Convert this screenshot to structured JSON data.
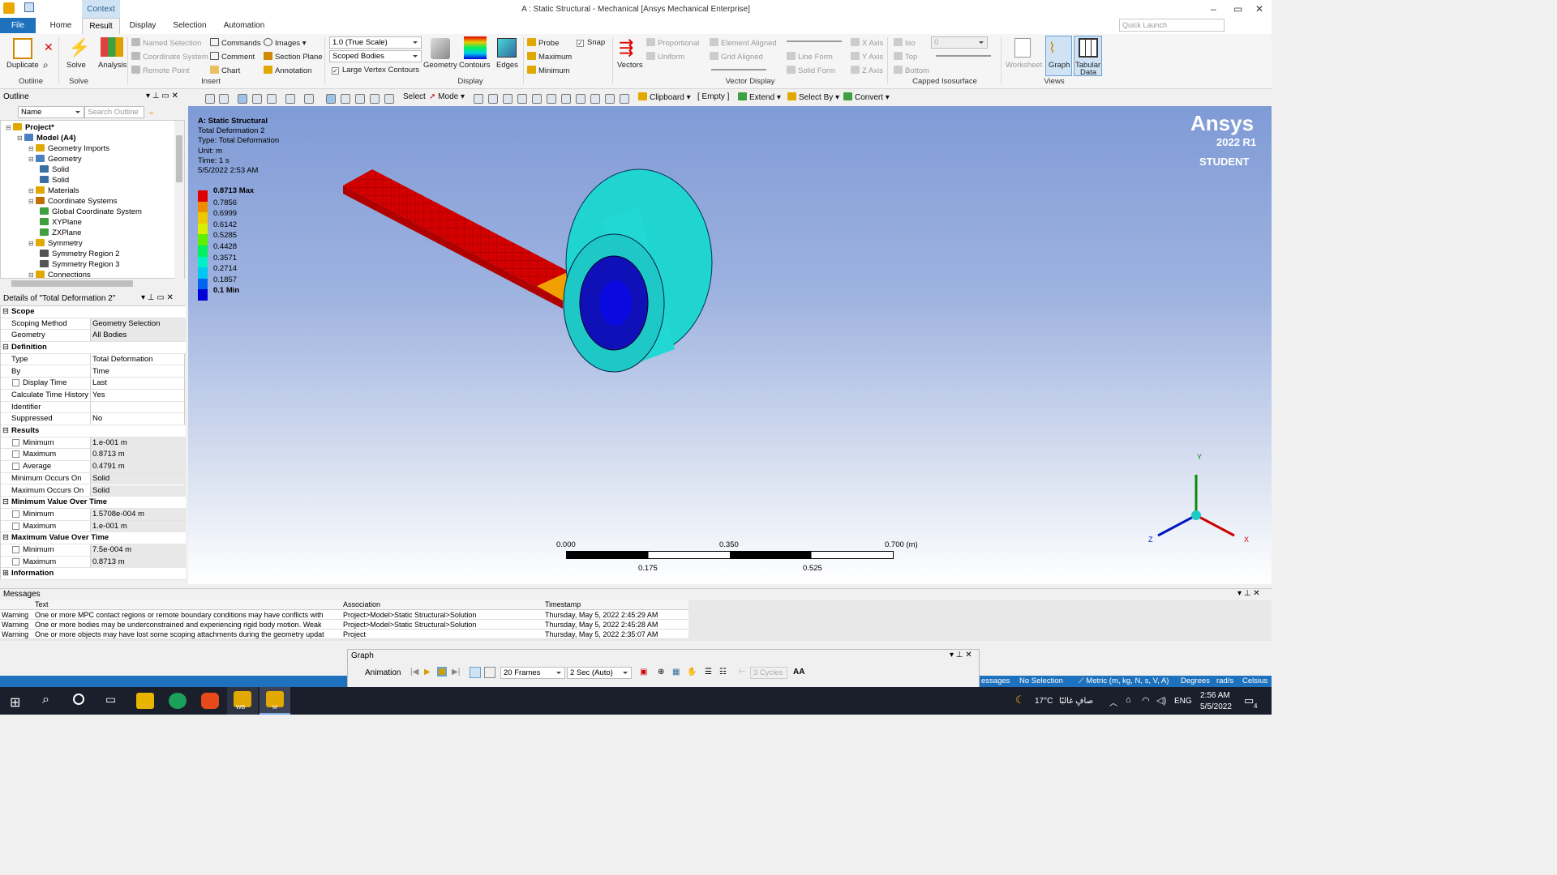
{
  "window": {
    "title": "A : Static Structural - Mechanical [Ansys Mechanical Enterprise]",
    "context_tab": "Context",
    "controls": [
      "–",
      "▭",
      "✕"
    ]
  },
  "ribbon_tabs": [
    "File",
    "Home",
    "Result",
    "Display",
    "Selection",
    "Automation"
  ],
  "quick_launch_placeholder": "Quick Launch",
  "ribbon": {
    "outline_group": "Outline",
    "duplicate": "Duplicate",
    "solve": "Solve",
    "solve_group": "Solve",
    "analysis": "Analysis",
    "named_selection": "Named Selection",
    "coordinate_system": "Coordinate System",
    "remote_point": "Remote Point",
    "commands": "Commands",
    "comment": "Comment",
    "chart": "Chart",
    "images": "Images",
    "section_plane": "Section Plane",
    "annotation": "Annotation",
    "insert_group": "Insert",
    "scale_value": "1.0 (True Scale)",
    "scoped_bodies": "Scoped Bodies",
    "large_vertex_contours": "Large Vertex Contours",
    "geometry": "Geometry",
    "contours": "Contours",
    "edges": "Edges",
    "display_group": "Display",
    "probe": "Probe",
    "maximum": "Maximum",
    "minimum": "Minimum",
    "snap": "Snap",
    "vectors": "Vectors",
    "proportional": "Proportional",
    "uniform": "Uniform",
    "element_aligned": "Element Aligned",
    "grid_aligned": "Grid Aligned",
    "line_form": "Line Form",
    "solid_form": "Solid Form",
    "x_axis": "X Axis",
    "y_axis": "Y Axis",
    "z_axis": "Z Axis",
    "vector_display_group": "Vector Display",
    "iso": "Iso",
    "top": "Top",
    "bottom": "Bottom",
    "iso_value": "0",
    "capped_group": "Capped Isosurface",
    "worksheet": "Worksheet",
    "graph": "Graph",
    "tabular_data_1": "Tabular",
    "tabular_data_2": "Data",
    "views_group": "Views"
  },
  "toolbar": {
    "select": "Select",
    "mode": "Mode",
    "clipboard": "Clipboard",
    "empty": "[ Empty ]",
    "extend": "Extend",
    "select_by": "Select By",
    "convert": "Convert"
  },
  "outline": {
    "header": "Outline",
    "name_filter": "Name",
    "search_placeholder": "Search Outline",
    "items": [
      {
        "label": "Project*",
        "depth": 0
      },
      {
        "label": "Model (A4)",
        "depth": 1
      },
      {
        "label": "Geometry Imports",
        "depth": 2
      },
      {
        "label": "Geometry",
        "depth": 2
      },
      {
        "label": "Solid",
        "depth": 3
      },
      {
        "label": "Solid",
        "depth": 3
      },
      {
        "label": "Materials",
        "depth": 2
      },
      {
        "label": "Coordinate Systems",
        "depth": 2
      },
      {
        "label": "Global Coordinate System",
        "depth": 3
      },
      {
        "label": "XYPlane",
        "depth": 3
      },
      {
        "label": "ZXPlane",
        "depth": 3
      },
      {
        "label": "Symmetry",
        "depth": 2
      },
      {
        "label": "Symmetry Region 2",
        "depth": 3
      },
      {
        "label": "Symmetry Region 3",
        "depth": 3
      },
      {
        "label": "Connections",
        "depth": 2
      }
    ]
  },
  "details": {
    "header": "Details of \"Total Deformation 2\"",
    "rows": [
      {
        "section": "Scope"
      },
      {
        "k": "Scoping Method",
        "v": "Geometry Selection",
        "gray": true
      },
      {
        "k": "Geometry",
        "v": "All Bodies",
        "gray": true
      },
      {
        "section": "Definition"
      },
      {
        "k": "Type",
        "v": "Total Deformation"
      },
      {
        "k": "By",
        "v": "Time"
      },
      {
        "k": "Display Time",
        "v": "Last",
        "chk": true
      },
      {
        "k": "Calculate Time History",
        "v": "Yes"
      },
      {
        "k": "Identifier",
        "v": ""
      },
      {
        "k": "Suppressed",
        "v": "No"
      },
      {
        "section": "Results"
      },
      {
        "k": "Minimum",
        "v": "1.e-001 m",
        "gray": true,
        "chk": true
      },
      {
        "k": "Maximum",
        "v": "0.8713 m",
        "gray": true,
        "chk": true
      },
      {
        "k": "Average",
        "v": "0.4791 m",
        "gray": true,
        "chk": true
      },
      {
        "k": "Minimum Occurs On",
        "v": "Solid",
        "gray": true
      },
      {
        "k": "Maximum Occurs On",
        "v": "Solid",
        "gray": true
      },
      {
        "section": "Minimum Value Over Time"
      },
      {
        "k": "Minimum",
        "v": "1.5708e-004 m",
        "gray": true,
        "chk": true
      },
      {
        "k": "Maximum",
        "v": "1.e-001 m",
        "gray": true,
        "chk": true
      },
      {
        "section": "Maximum Value Over Time"
      },
      {
        "k": "Minimum",
        "v": "7.5e-004 m",
        "gray": true,
        "chk": true
      },
      {
        "k": "Maximum",
        "v": "0.8713 m",
        "gray": true,
        "chk": true
      },
      {
        "section": "Information",
        "plus": true
      }
    ]
  },
  "viewport": {
    "info": [
      "A: Static Structural",
      "Total Deformation 2",
      "Type: Total Deformation",
      "Unit: m",
      "Time: 1 s",
      "5/5/2022 2:53 AM"
    ],
    "brand": "Ansys",
    "version": "2022 R1",
    "edition": "STUDENT",
    "legend": [
      {
        "label": "0.8713 Max",
        "color": "#e00000",
        "bold": true
      },
      {
        "label": "0.7856",
        "color": "#f08c00"
      },
      {
        "label": "0.6999",
        "color": "#f0c800"
      },
      {
        "label": "0.6142",
        "color": "#d8f000"
      },
      {
        "label": "0.5285",
        "color": "#5ef000"
      },
      {
        "label": "0.4428",
        "color": "#00f060"
      },
      {
        "label": "0.3571",
        "color": "#00f0c8"
      },
      {
        "label": "0.2714",
        "color": "#00c8f0"
      },
      {
        "label": "0.1857",
        "color": "#0064f0"
      },
      {
        "label": "0.1 Min",
        "color": "#0000d8",
        "bold": true
      }
    ],
    "scale": {
      "ticks_top": [
        "0.000",
        "0.350",
        "0.700 (m)"
      ],
      "ticks_bottom": [
        "0.175",
        "0.525"
      ]
    },
    "axes": {
      "x": "X",
      "y": "Y",
      "z": "Z"
    }
  },
  "messages": {
    "header": "Messages",
    "columns": [
      "Text",
      "Association",
      "Timestamp"
    ],
    "rows": [
      {
        "type": "Warning",
        "text": "One or more MPC contact regions or remote boundary conditions may have conflicts with",
        "assoc": "Project>Model>Static Structural>Solution",
        "time": "Thursday, May 5, 2022 2:45:29 AM"
      },
      {
        "type": "Warning",
        "text": "One or more bodies may be underconstrained and experiencing rigid body motion. Weak",
        "assoc": "Project>Model>Static Structural>Solution",
        "time": "Thursday, May 5, 2022 2:45:28 AM"
      },
      {
        "type": "Warning",
        "text": "One or more objects may have lost some scoping attachments during the geometry updat",
        "assoc": "Project",
        "time": "Thursday, May 5, 2022 2:35:07 AM"
      }
    ]
  },
  "graph": {
    "header": "Graph",
    "animation": "Animation",
    "frames": "20 Frames",
    "duration": "2 Sec (Auto)",
    "cycles": "3 Cycles",
    "aa": "AA"
  },
  "statusbar": {
    "messages": "essages",
    "selection": "No Selection",
    "units": "Metric (m, kg, N, s, V, A)",
    "degrees": "Degrees",
    "rads": "rad/s",
    "temp": "Celsius"
  },
  "taskbar": {
    "weather": "17°C",
    "weather_text": "صافٍ غالبًا",
    "lang": "ENG",
    "time": "2:56 AM",
    "date": "5/5/2022",
    "notifications": "4",
    "wb_label": "WB",
    "m_label": "M"
  }
}
